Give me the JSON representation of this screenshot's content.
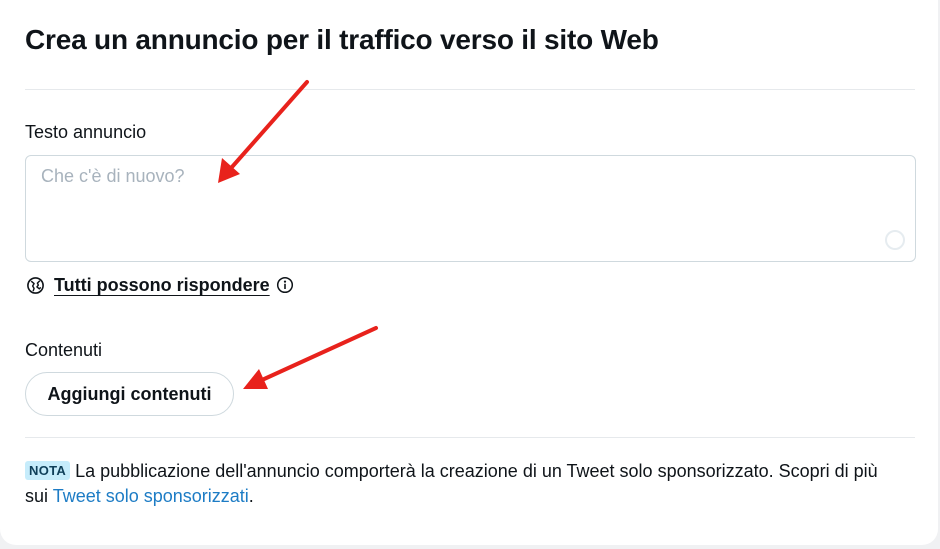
{
  "header": {
    "title": "Crea un annuncio per il traffico verso il sito Web"
  },
  "ad_text": {
    "label": "Testo annuncio",
    "placeholder": "Che c'è di nuovo?",
    "value": ""
  },
  "reply_settings": {
    "label": "Tutti possono rispondere",
    "icon": "globe-icon",
    "info_icon": "info-icon"
  },
  "contents": {
    "label": "Contenuti",
    "add_button_label": "Aggiungi contenuti"
  },
  "note": {
    "badge": "NOTA",
    "text_before": "La pubblicazione dell'annuncio comporterà la creazione di un Tweet solo sponsorizzato. Scopri di più sui",
    "link_label": "Tweet solo sponsorizzati",
    "text_after": "."
  },
  "colors": {
    "accent_link": "#1d7cc5",
    "badge_bg": "#c6ecfb",
    "annotation_arrow": "#e8221c"
  }
}
